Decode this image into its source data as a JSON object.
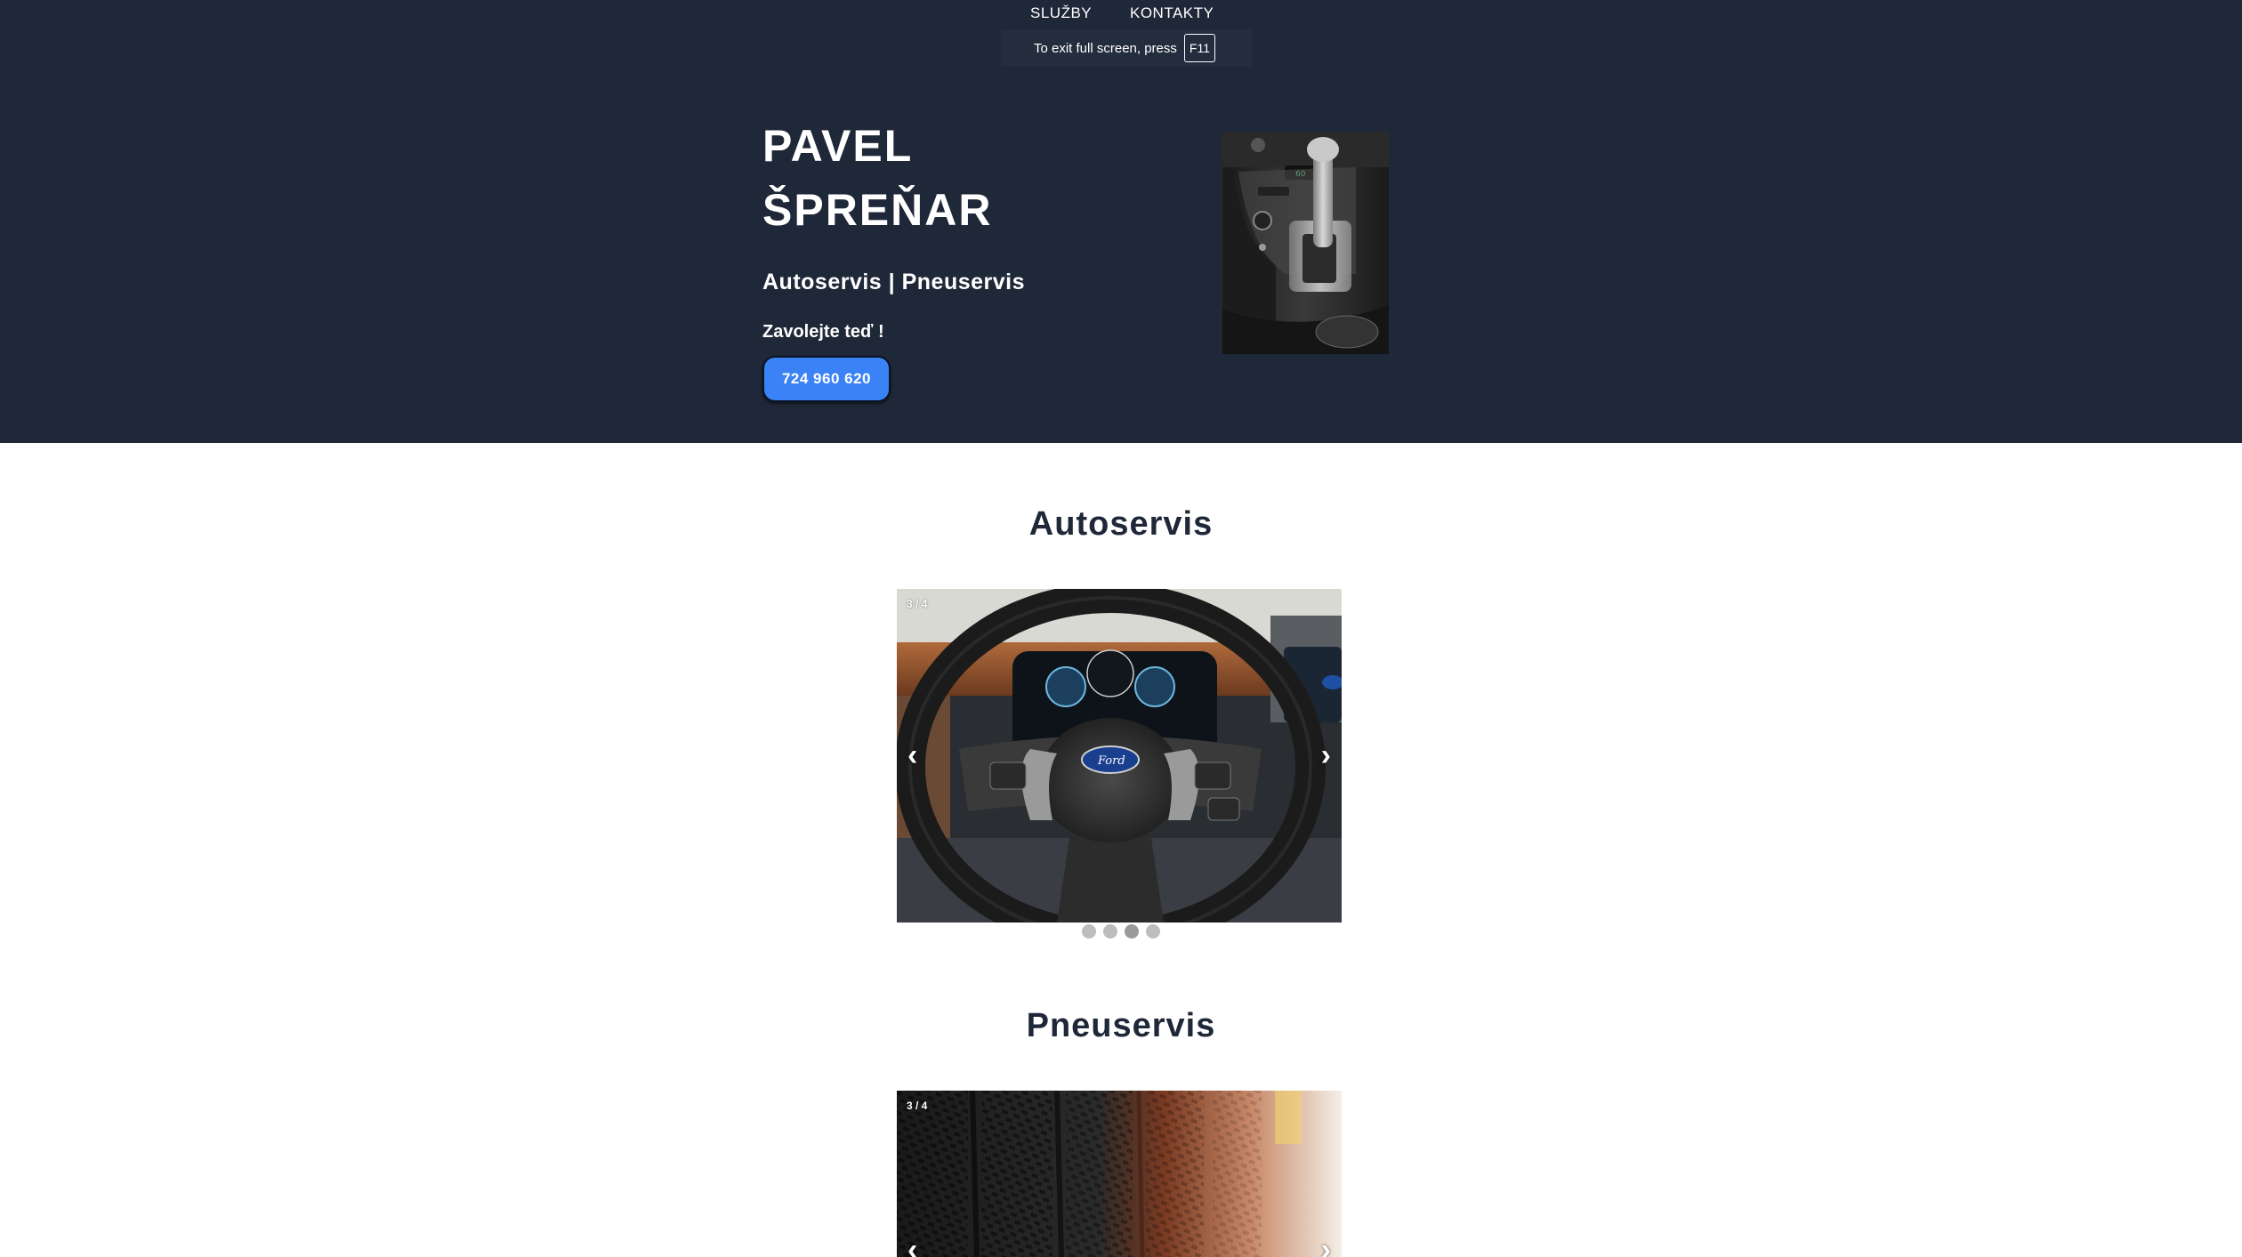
{
  "nav": {
    "items": [
      {
        "label": "SLUŽBY"
      },
      {
        "label": "KONTAKTY"
      }
    ]
  },
  "fullscreen_notice": {
    "text": "To exit full screen, press",
    "key": "F11"
  },
  "hero": {
    "name_line1": "PAVEL",
    "name_line2": "ŠPREŇAR",
    "subtitle": "Autoservis | Pneuservis",
    "cta_text": "Zavolejte teď !",
    "phone": "724 960 620",
    "background_color": "#1f2838",
    "button_color": "#3b82f6"
  },
  "sections": [
    {
      "title": "Autoservis",
      "carousel": {
        "counter": "3 / 4",
        "prev": "‹",
        "next": "›",
        "slide_count": 4,
        "current_slide": 3,
        "image": "ford-steering-wheel"
      }
    },
    {
      "title": "Pneuservis",
      "carousel": {
        "counter": "3 / 4",
        "prev": "‹",
        "next": "›",
        "image": "tires-row"
      }
    }
  ]
}
